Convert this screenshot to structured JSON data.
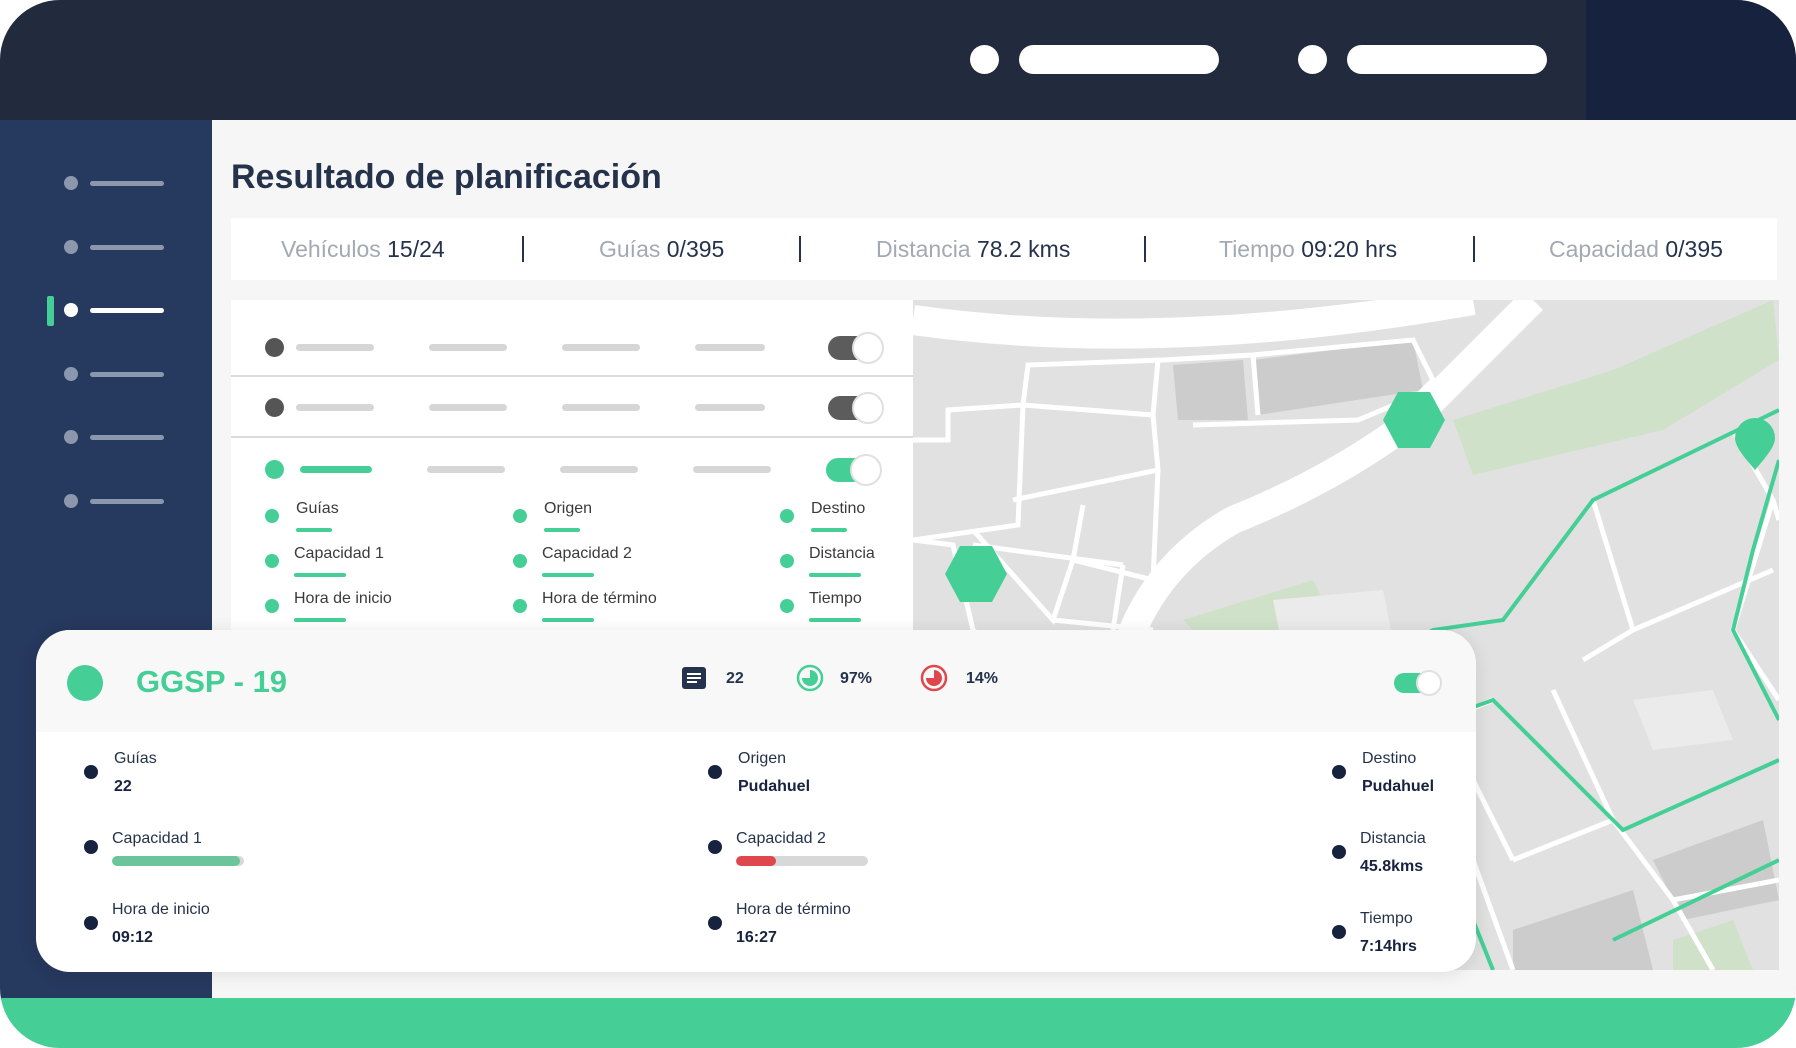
{
  "page": {
    "title": "Resultado de planificación"
  },
  "stats": [
    {
      "label": "Vehículos",
      "value": "15/24"
    },
    {
      "label": "Guías",
      "value": "0/395"
    },
    {
      "label": "Distancia",
      "value": "78.2 kms"
    },
    {
      "label": "Tiempo",
      "value": "09:20 hrs"
    },
    {
      "label": "Capacidad",
      "value": "0/395"
    }
  ],
  "list": {
    "expanded_fields": [
      "Guías",
      "Origen",
      "Destino",
      "Capacidad 1",
      "Capacidad 2",
      "Distancia",
      "Hora de inicio",
      "Hora de término",
      "Tiempo"
    ]
  },
  "card": {
    "title": "GGSP - 19",
    "guides_count": "22",
    "capacity_1_pct": "97%",
    "capacity_2_pct": "14%",
    "enabled": true,
    "fields": {
      "guias": {
        "label": "Guías",
        "value": "22"
      },
      "capacidad1": {
        "label": "Capacidad 1",
        "fraction": 0.97
      },
      "hora_inicio": {
        "label": "Hora de inicio",
        "value": "09:12"
      },
      "origen": {
        "label": "Origen",
        "value": "Pudahuel"
      },
      "capacidad2": {
        "label": "Capacidad 2",
        "fraction": 0.3
      },
      "hora_termino": {
        "label": "Hora de término",
        "value": "16:27"
      },
      "destino": {
        "label": "Destino",
        "value": "Pudahuel"
      },
      "distancia": {
        "label": "Distancia",
        "value": "45.8kms"
      },
      "tiempo": {
        "label": "Tiempo",
        "value": "7:14hrs"
      }
    }
  },
  "colors": {
    "accent": "#45cf96",
    "navy": "#222b3e",
    "sidebar": "#26395e",
    "alert": "#e0474c",
    "capacity_bar": "#6cc49a"
  },
  "icons": [
    "document-icon",
    "capacity-gauge-icon",
    "alert-gauge-icon",
    "map-pin-icon",
    "hexagon-marker-icon"
  ]
}
